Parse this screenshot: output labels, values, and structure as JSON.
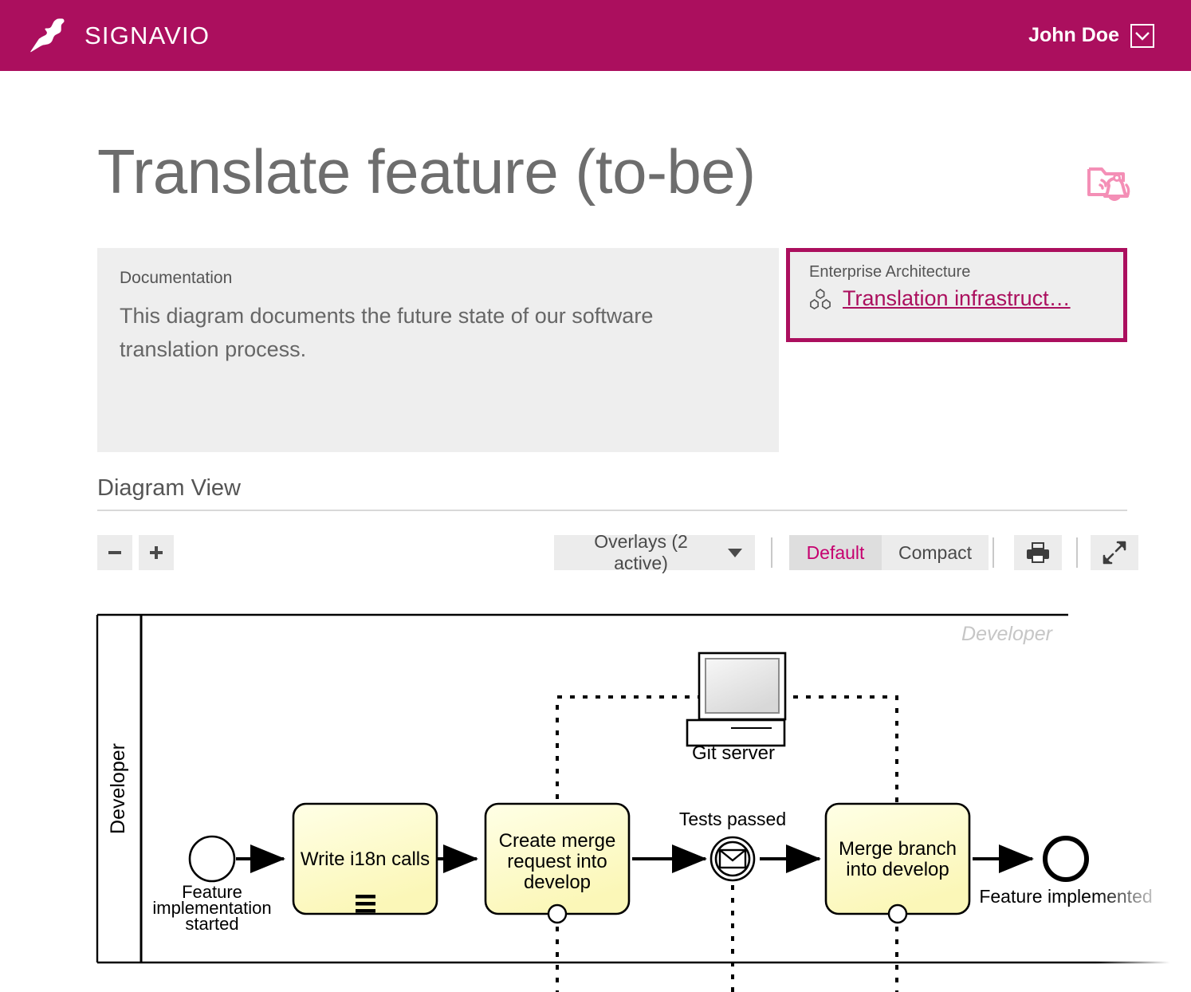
{
  "header": {
    "brand_name": "SIGNAVIO",
    "logo_icon": "signavio-gazelle-logo",
    "user_name": "John Doe",
    "caret_icon": "chevron-down-icon",
    "brand_color": "#ab0f5e"
  },
  "page": {
    "title": "Translate feature (to-be)",
    "subscribe_icon": "folder-bell-subscribe-icon",
    "subscribe_icon_color": "#f48fb6"
  },
  "documentation": {
    "label": "Documentation",
    "text": "This diagram documents the future state of our software translation process."
  },
  "enterprise_architecture": {
    "label": "Enterprise Architecture",
    "icon": "architecture-nodes-icon",
    "link_text": "Translation infrastruct…",
    "border_color": "#ab0f5e",
    "link_color": "#ab0f5e"
  },
  "section": {
    "title": "Diagram View"
  },
  "toolbar": {
    "zoom_out_label": "–",
    "zoom_out_icon": "minus-icon",
    "zoom_in_label": "+",
    "zoom_in_icon": "plus-icon",
    "overlays_label": "Overlays (2 active)",
    "overlays_caret_icon": "chevron-down-icon",
    "view_default_label": "Default",
    "view_compact_label": "Compact",
    "print_icon": "printer-icon",
    "expand_icon": "fullscreen-expand-icon",
    "active_view": "Default",
    "active_color": "#c6006f"
  },
  "diagram": {
    "type": "bpmn",
    "pool_watermark": "Developer",
    "lane_label": "Developer",
    "task_fill": "#fdfbd0",
    "task_fill_2": "#fffce8",
    "nodes": [
      {
        "id": "start",
        "kind": "start-event",
        "label": "Feature implementation started"
      },
      {
        "id": "task1",
        "kind": "task",
        "label": "Write i18n calls",
        "marker": "manual-task-icon"
      },
      {
        "id": "task2",
        "kind": "task",
        "label": "Create merge request into develop",
        "marker": "collapsed-subprocess-marker"
      },
      {
        "id": "catch",
        "kind": "intermediate-message-catch-event",
        "label": "Tests passed",
        "marker": "envelope-icon"
      },
      {
        "id": "task3",
        "kind": "task",
        "label": "Merge branch into develop",
        "marker": "collapsed-subprocess-marker"
      },
      {
        "id": "end",
        "kind": "end-event",
        "label": "Feature implemented"
      },
      {
        "id": "gitserver",
        "kind": "data-store-computer",
        "label": "Git server",
        "icon": "computer-icon"
      }
    ],
    "flows": [
      {
        "from": "start",
        "to": "task1",
        "style": "sequence"
      },
      {
        "from": "task1",
        "to": "task2",
        "style": "sequence"
      },
      {
        "from": "task2",
        "to": "catch",
        "style": "sequence"
      },
      {
        "from": "catch",
        "to": "task3",
        "style": "sequence"
      },
      {
        "from": "task3",
        "to": "end",
        "style": "sequence"
      },
      {
        "from": "task2",
        "to": "gitserver",
        "style": "message"
      },
      {
        "from": "gitserver",
        "to": "task3",
        "style": "message"
      },
      {
        "from": "catch",
        "to": "below",
        "style": "message"
      }
    ]
  }
}
